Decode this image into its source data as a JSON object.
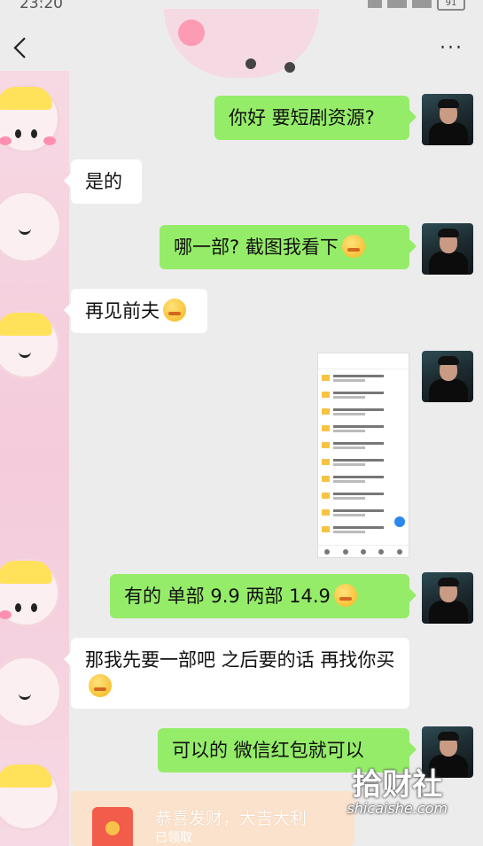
{
  "status_bar": {
    "time": "23:20",
    "battery": "91"
  },
  "nav": {
    "back_icon": "chevron-left-icon",
    "more_icon": "more-dots-icon",
    "more_label": "···"
  },
  "messages": [
    {
      "side": "me",
      "text": "你好  要短剧资源?"
    },
    {
      "side": "them",
      "text": "是的"
    },
    {
      "side": "me",
      "text": "哪一部?  截图我看下",
      "emoji": "smirk-emoji"
    },
    {
      "side": "them",
      "text": "再见前夫",
      "emoji": "laugh-cry-emoji"
    },
    {
      "side": "me",
      "type": "image",
      "image": "screenshot-of-file-list"
    },
    {
      "side": "me",
      "text": "有的   单部 9.9    两部 14.9",
      "emoji": "smirk-emoji"
    },
    {
      "side": "them",
      "text": "那我先要一部吧    之后要的话  再找你买",
      "emoji": "smirk-emoji"
    },
    {
      "side": "me",
      "text": "可以的   微信红包就可以"
    }
  ],
  "red_packet": {
    "title": "恭喜发财，大吉大利",
    "status": "已领取"
  },
  "watermark": {
    "main": "拾财社",
    "sub": "shicaishe.com"
  },
  "colors": {
    "me_bubble": "#95ec69",
    "them_bubble": "#ffffff",
    "background": "#ececec"
  }
}
